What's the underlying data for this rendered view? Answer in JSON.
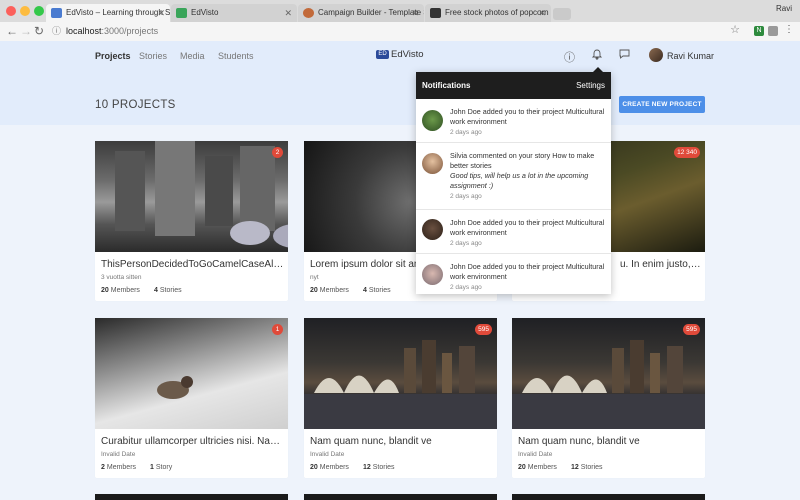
{
  "browser": {
    "tabs": [
      {
        "title": "EdVisto – Learning through St",
        "active": true,
        "favicon_color": "#4a7bd0"
      },
      {
        "title": "EdVisto",
        "active": false,
        "favicon_color": "#3aa55a"
      },
      {
        "title": "Campaign Builder - Template St",
        "active": false,
        "favicon_color": "#c26a3a"
      },
      {
        "title": "Free stock photos of popcorn",
        "active": false,
        "favicon_color": "#333333"
      }
    ],
    "profile_name": "Ravi",
    "url_host": "localhost",
    "url_path": ":3000/projects"
  },
  "nav": {
    "items": [
      "Projects",
      "Stories",
      "Media",
      "Students"
    ],
    "active": "Projects"
  },
  "logo": {
    "mark": "ED",
    "text": "EdVisto"
  },
  "user": {
    "name": "Ravi Kumar"
  },
  "projects_count": "10 PROJECTS",
  "create_button": "CREATE NEW PROJECT",
  "colors": {
    "accent": "#4d8fe8",
    "badge": "#e04a3a",
    "header_bg": "#e2ecfb",
    "notif_header": "#1e1e1e"
  },
  "cards": [
    {
      "title": "ThisPersonDecidedToGoCamelCaseAllThe",
      "date": "3 vuotta sitten",
      "members": "20",
      "members_label": "Members",
      "stories": "4",
      "stories_label": "Stories",
      "badge": "2",
      "image": "city"
    },
    {
      "title": "Lorem ipsum dolor sit amet",
      "date": "nyt",
      "members": "20",
      "members_label": "Members",
      "stories": "4",
      "stories_label": "Stories",
      "badge": "",
      "image": "wolf"
    },
    {
      "title": "u. In enim justo, rho...",
      "date": "",
      "members": "",
      "members_label": "",
      "stories": "",
      "stories_label": "",
      "badge": "12 340",
      "image": "forest"
    },
    {
      "title": "Curabitur ullamcorper ultricies nisi. Nam ...",
      "date": "Invalid Date",
      "members": "2",
      "members_label": "Members",
      "stories": "1",
      "stories_label": "Story",
      "badge": "1",
      "image": "snow"
    },
    {
      "title": "Nam quam nunc, blandit ve",
      "date": "Invalid Date",
      "members": "20",
      "members_label": "Members",
      "stories": "12",
      "stories_label": "Stories",
      "badge": "595",
      "image": "sydney"
    },
    {
      "title": "Nam quam nunc, blandit ve",
      "date": "Invalid Date",
      "members": "20",
      "members_label": "Members",
      "stories": "12",
      "stories_label": "Stories",
      "badge": "595",
      "image": "sydney"
    }
  ],
  "notifications": {
    "title": "Notifications",
    "settings": "Settings",
    "items": [
      {
        "text": "John Doe added you to their project Multicultural work environment",
        "quote": "",
        "time": "2 days ago",
        "avatar": "green"
      },
      {
        "text": "Silvia commented on your story How to make better stories",
        "quote": "Good tips, will help us a lot in the upcoming assignment :)",
        "time": "2 days ago",
        "avatar": "woman"
      },
      {
        "text": "John Doe added you to their project Multicultural work environment",
        "quote": "",
        "time": "2 days ago",
        "avatar": "brown"
      },
      {
        "text": "John Doe added you to their project Multicultural work environment",
        "quote": "",
        "time": "2 days ago",
        "avatar": "child"
      }
    ]
  }
}
